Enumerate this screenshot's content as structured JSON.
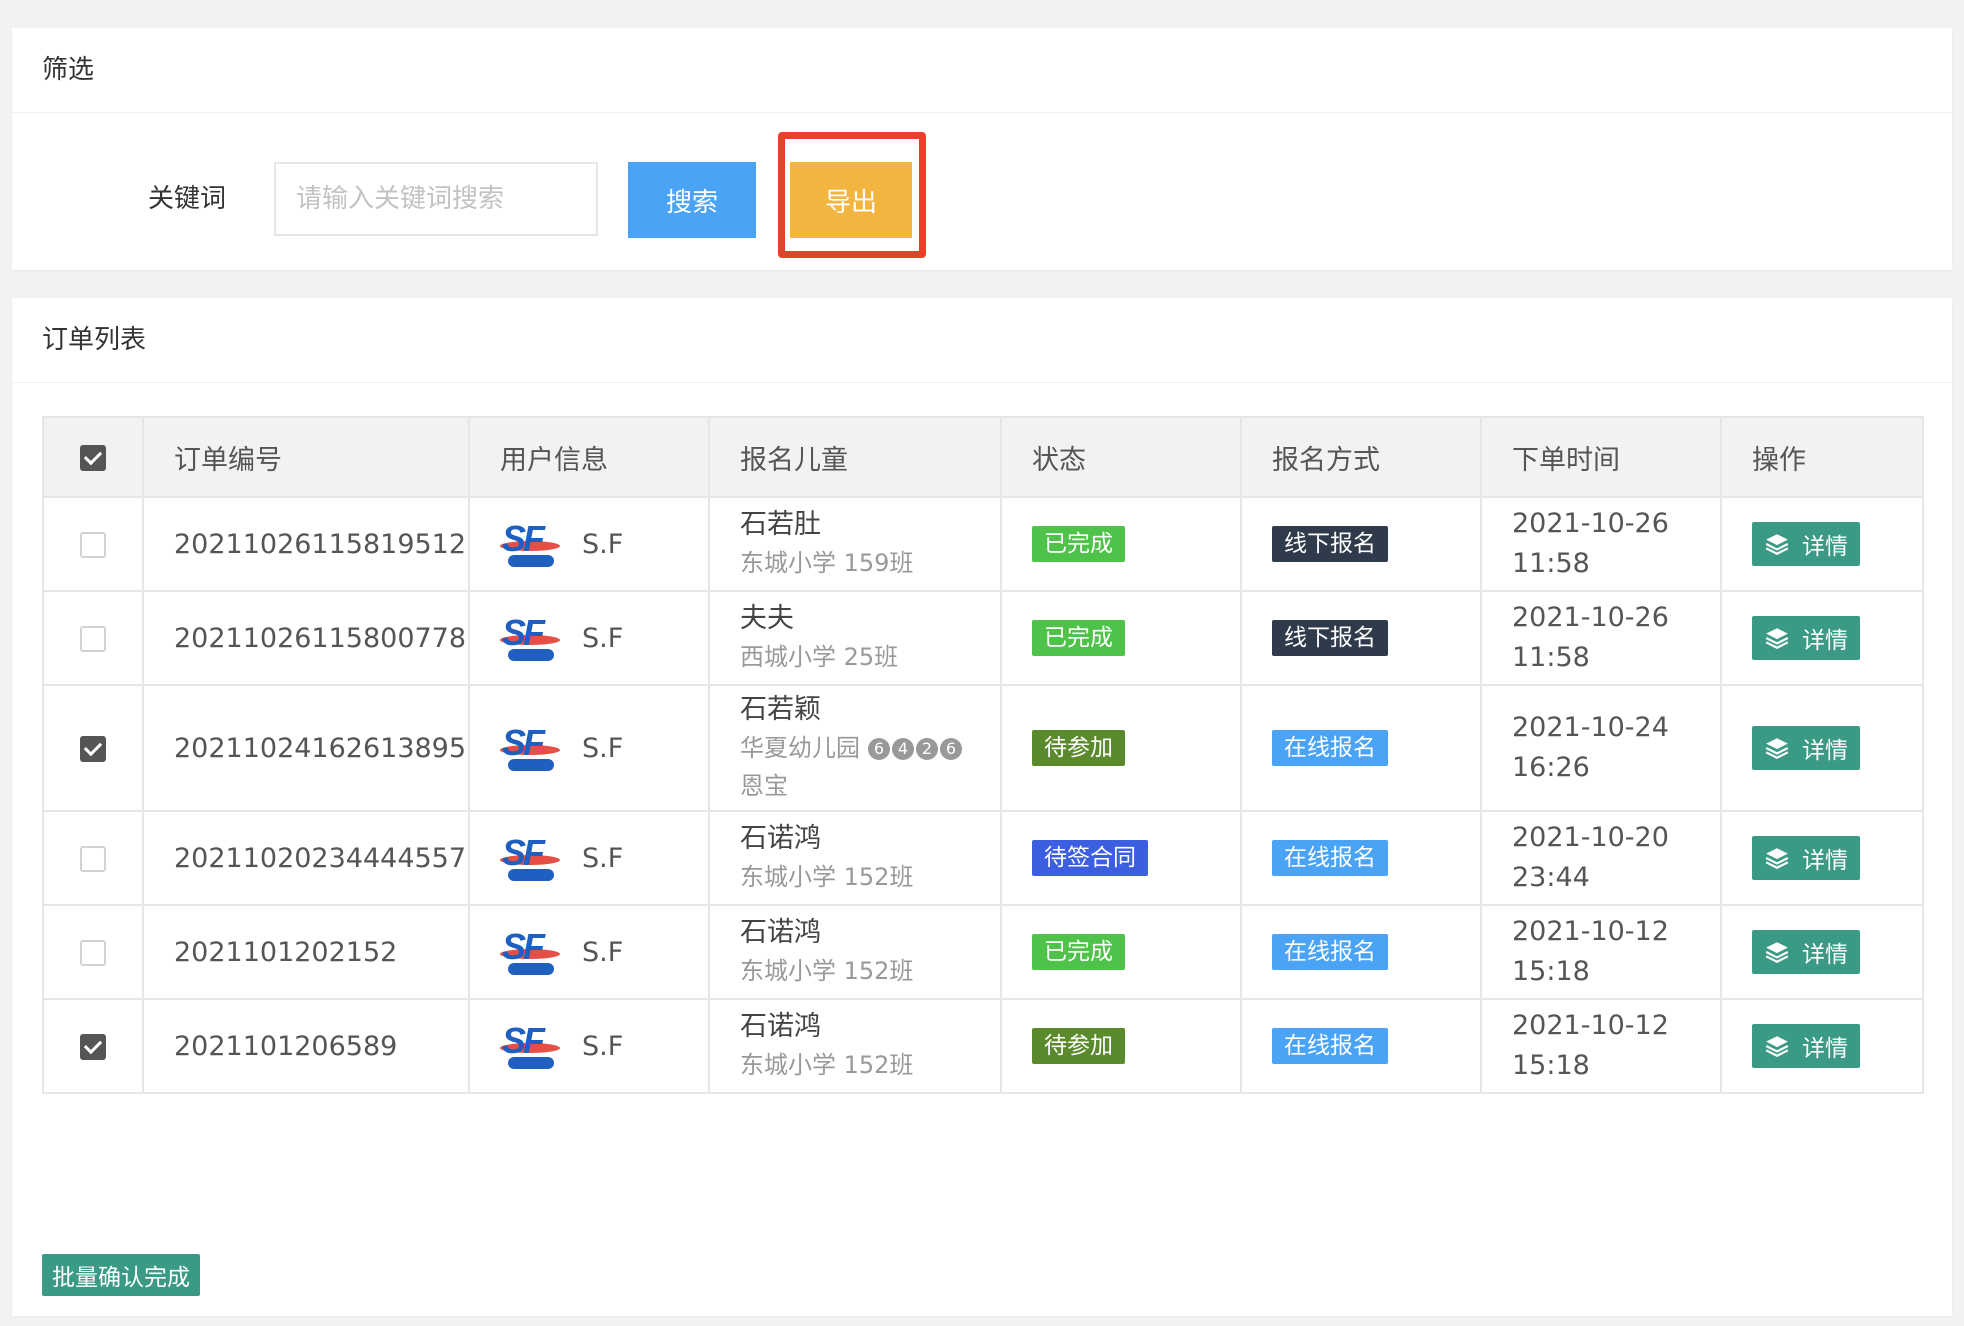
{
  "filter": {
    "title": "筛选",
    "keyword_label": "关键词",
    "keyword_placeholder": "请输入关键词搜索",
    "keyword_value": "",
    "search_label": "搜索",
    "export_label": "导出"
  },
  "list": {
    "title": "订单列表",
    "columns": [
      "订单编号",
      "用户信息",
      "报名儿童",
      "状态",
      "报名方式",
      "下单时间",
      "操作"
    ],
    "header_checked": true,
    "rows": [
      {
        "checked": false,
        "order_no": "20211026115819512",
        "user": "S.F",
        "child_name": "石若肚",
        "child_school": "东城小学 159班",
        "status": "已完成",
        "method": "线下报名",
        "date": "2021-10-26",
        "time": "11:58",
        "action": "详情"
      },
      {
        "checked": false,
        "order_no": "20211026115800778",
        "user": "S.F",
        "child_name": "夫夫",
        "child_school": "西城小学 25班",
        "status": "已完成",
        "method": "线下报名",
        "date": "2021-10-26",
        "time": "11:58",
        "action": "详情"
      },
      {
        "checked": true,
        "order_no": "20211024162613895",
        "user": "S.F",
        "child_name": "石若颖",
        "child_school": "华夏幼儿园",
        "child_school_nums": [
          "6",
          "4",
          "2",
          "6"
        ],
        "child_school_extra": "恩宝",
        "status": "待参加",
        "method": "在线报名",
        "date": "2021-10-24",
        "time": "16:26",
        "action": "详情"
      },
      {
        "checked": false,
        "order_no": "20211020234444557",
        "user": "S.F",
        "child_name": "石诺鸿",
        "child_school": "东城小学 152班",
        "status": "待签合同",
        "method": "在线报名",
        "date": "2021-10-20",
        "time": "23:44",
        "action": "详情"
      },
      {
        "checked": false,
        "order_no": "2021101202152",
        "user": "S.F",
        "child_name": "石诺鸿",
        "child_school": "东城小学 152班",
        "status": "已完成",
        "method": "在线报名",
        "date": "2021-10-12",
        "time": "15:18",
        "action": "详情"
      },
      {
        "checked": true,
        "order_no": "2021101206589",
        "user": "S.F",
        "child_name": "石诺鸿",
        "child_school": "东城小学 152班",
        "status": "待参加",
        "method": "在线报名",
        "date": "2021-10-12",
        "time": "15:18",
        "action": "详情"
      }
    ],
    "batch_label": "批量确认完成"
  },
  "colors": {
    "search_button": "#4aa3f5",
    "export_button": "#f2b540",
    "highlight_border": "#e8402a",
    "status_done": "#4fc24a",
    "status_pending": "#5a8a2c",
    "status_contract": "#3b5fe0",
    "method_offline": "#2f3a4b",
    "method_online": "#4aa3f5",
    "action_button": "#3a9a86"
  },
  "icons": {
    "detail": "layers-icon",
    "user_avatar": "sf-logo-icon"
  }
}
